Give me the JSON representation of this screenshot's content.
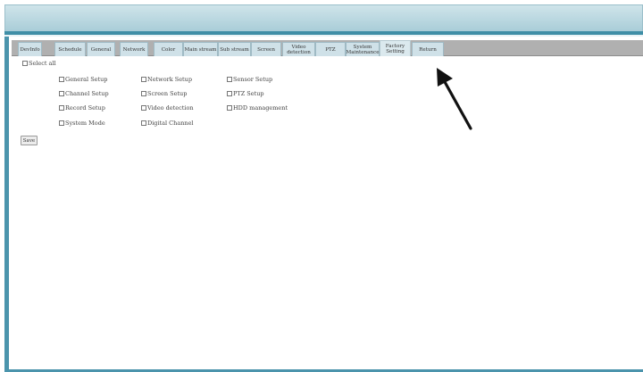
{
  "tabs": [
    {
      "label": "DevInfo"
    },
    {
      "label": "Schedule"
    },
    {
      "label": "General"
    },
    {
      "label": "Network"
    },
    {
      "label": "Color"
    },
    {
      "label": "Main stream"
    },
    {
      "label": "Sub stream"
    },
    {
      "label": "Screen"
    },
    {
      "label": "Video detection"
    },
    {
      "label": "PTZ"
    },
    {
      "label": "System Maintenance"
    },
    {
      "label": "Factory Setting"
    },
    {
      "label": "Return"
    }
  ],
  "select_all_label": "Select all",
  "options": [
    {
      "label": "General Setup"
    },
    {
      "label": "Network Setup"
    },
    {
      "label": "Sensor Setup"
    },
    {
      "label": "Channel Setup"
    },
    {
      "label": "Screen Setup"
    },
    {
      "label": "PTZ Setup"
    },
    {
      "label": "Record Setup"
    },
    {
      "label": "Video detection"
    },
    {
      "label": "HDD management"
    },
    {
      "label": "System Mode"
    },
    {
      "label": "Digital Channel"
    }
  ],
  "save_label": "Save",
  "colors": {
    "header_bar": "#a9cdd8",
    "frame_border": "#4b94ac",
    "tab_bg": "#cfe1e8",
    "tabstrip_bg": "#b0b0b0",
    "annotation_arrow": "#111111"
  },
  "annotation": {
    "icon": "arrow-pointer-icon"
  }
}
